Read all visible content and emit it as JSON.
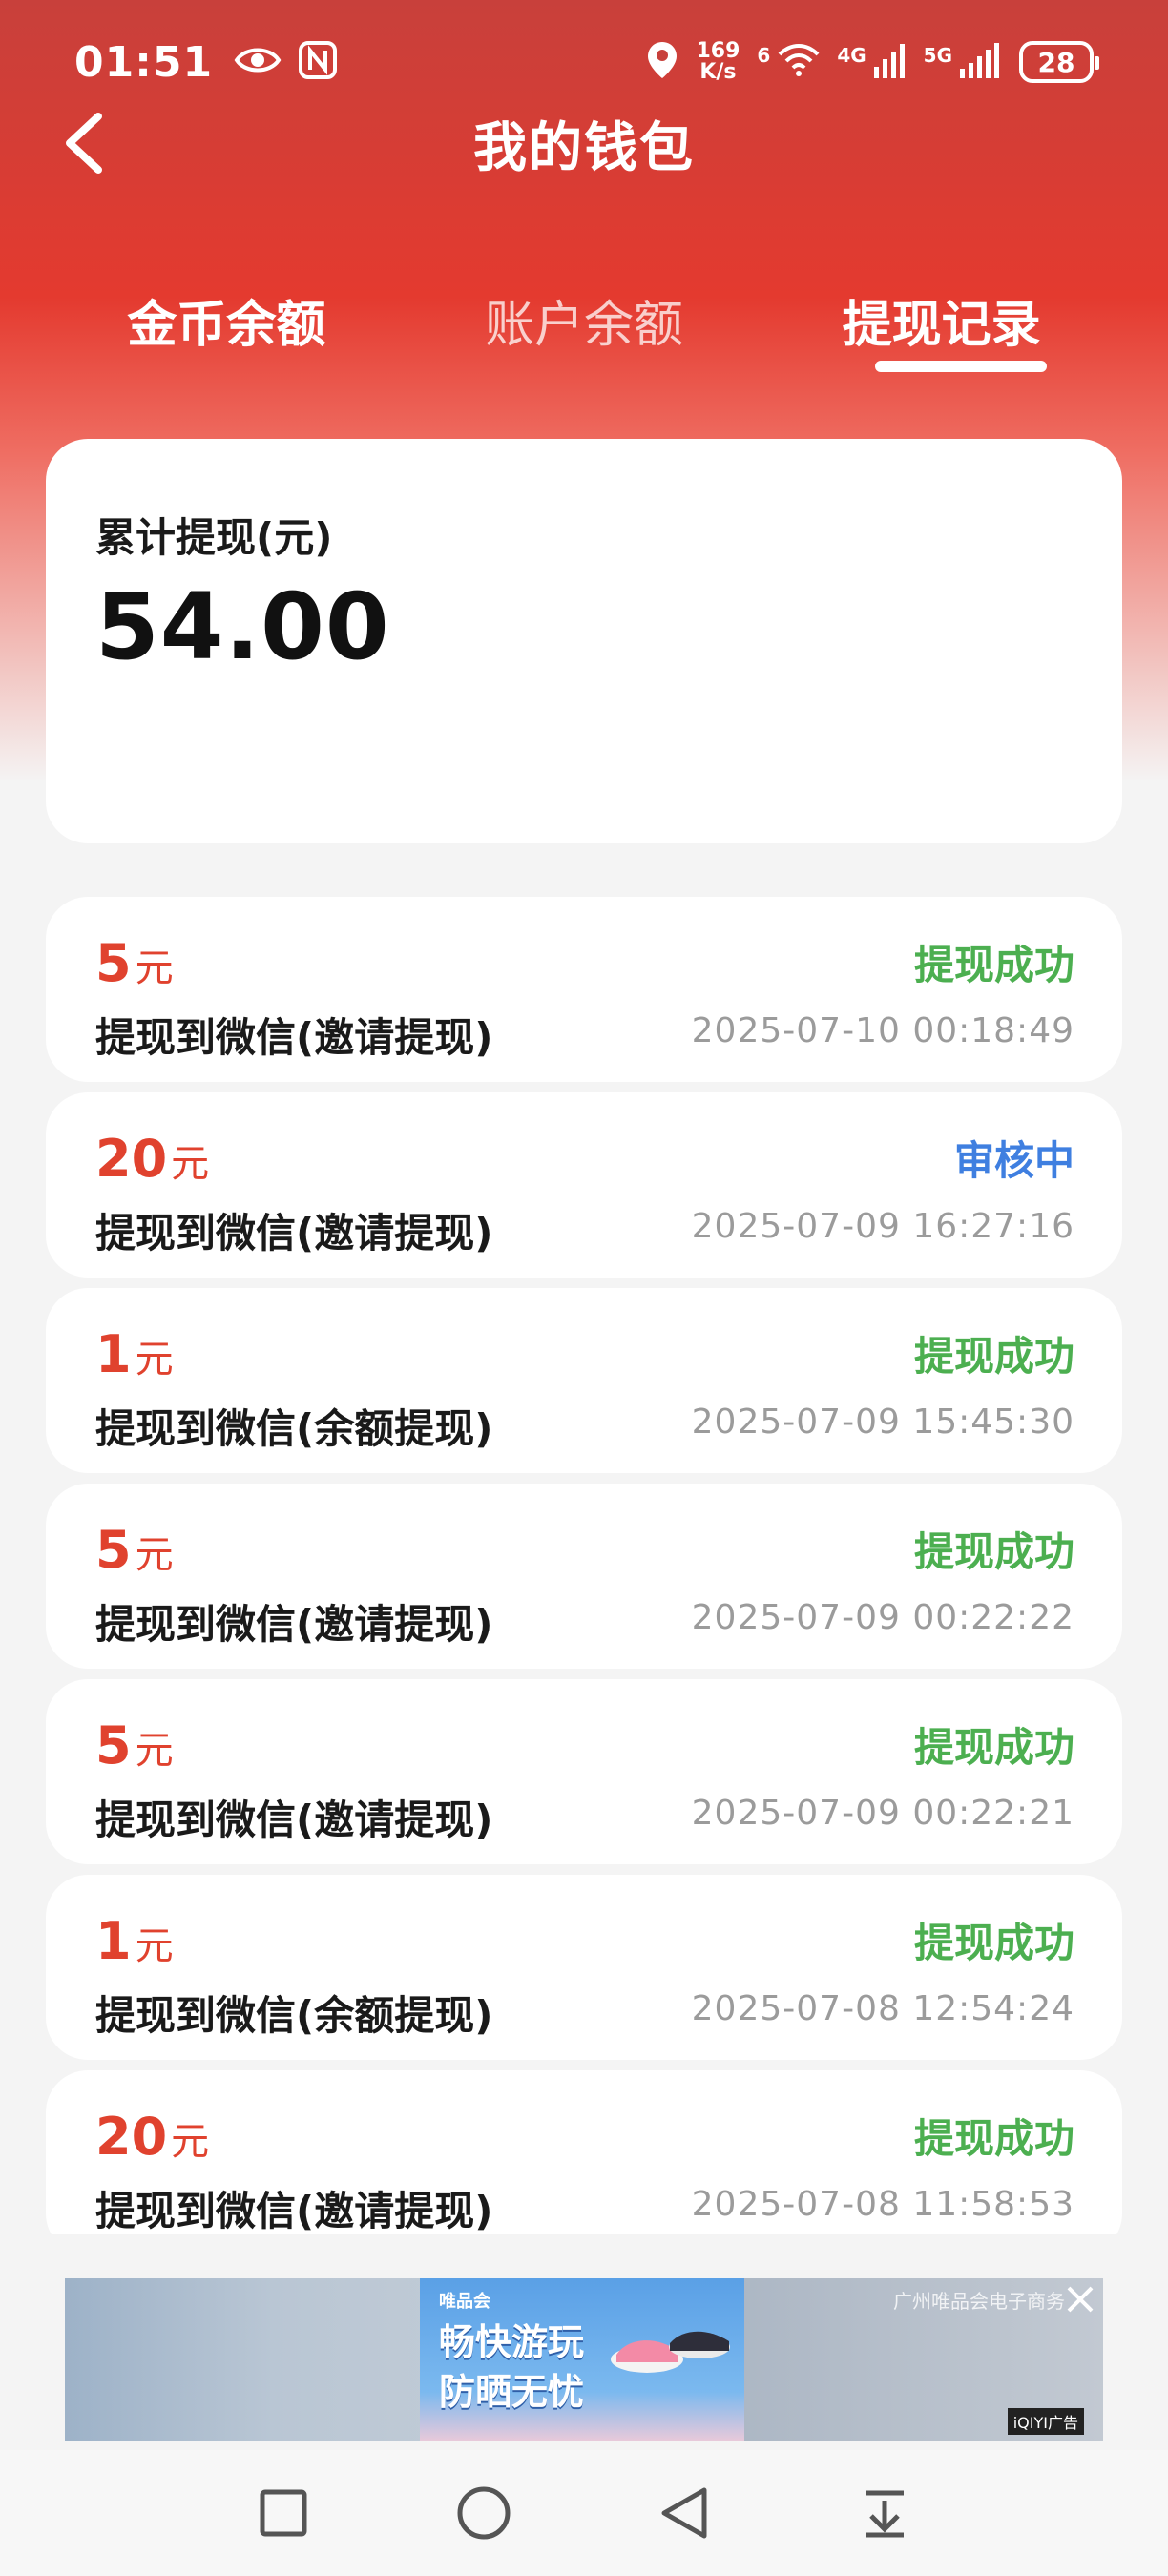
{
  "status_bar": {
    "time": "01:51",
    "speed_value": "169",
    "speed_unit": "K/s",
    "wifi_label": "6",
    "net1_label": "4G",
    "net2_label": "5G",
    "battery": "28"
  },
  "header": {
    "title": "我的钱包"
  },
  "tabs": [
    {
      "label": "金币余额"
    },
    {
      "label": "账户余额"
    },
    {
      "label": "提现记录"
    }
  ],
  "summary": {
    "label": "累计提现(元)",
    "value": "54.00"
  },
  "records": [
    {
      "amount": "5",
      "unit": "元",
      "desc": "提现到微信(邀请提现)",
      "status": "提现成功",
      "time": "2025-07-10 00:18:49"
    },
    {
      "amount": "20",
      "unit": "元",
      "desc": "提现到微信(邀请提现)",
      "status": "审核中",
      "time": "2025-07-09 16:27:16"
    },
    {
      "amount": "1",
      "unit": "元",
      "desc": "提现到微信(余额提现)",
      "status": "提现成功",
      "time": "2025-07-09 15:45:30"
    },
    {
      "amount": "5",
      "unit": "元",
      "desc": "提现到微信(邀请提现)",
      "status": "提现成功",
      "time": "2025-07-09 00:22:22"
    },
    {
      "amount": "5",
      "unit": "元",
      "desc": "提现到微信(邀请提现)",
      "status": "提现成功",
      "time": "2025-07-09 00:22:21"
    },
    {
      "amount": "1",
      "unit": "元",
      "desc": "提现到微信(余额提现)",
      "status": "提现成功",
      "time": "2025-07-08 12:54:24"
    },
    {
      "amount": "20",
      "unit": "元",
      "desc": "提现到微信(邀请提现)",
      "status": "提现成功",
      "time": "2025-07-08 11:58:53"
    }
  ],
  "ad": {
    "brand": "唯品会",
    "slogan_line1": "畅快游玩",
    "slogan_line2": "防晒无忧",
    "right_text": "广州唯品会电子商务",
    "badge": "iQIYI广告"
  },
  "colors": {
    "accent_red": "#e0422e",
    "success_green": "#4caf50",
    "pending_blue": "#3f7fe0"
  }
}
